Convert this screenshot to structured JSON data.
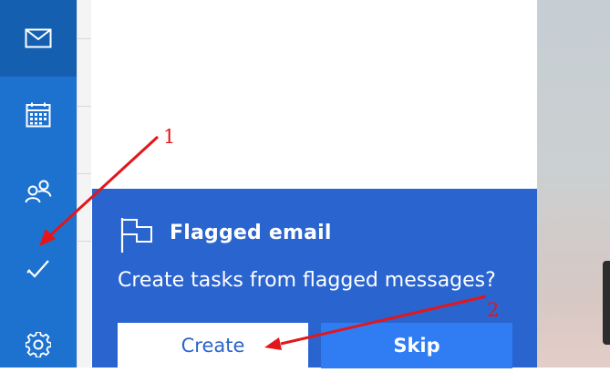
{
  "sidebar": {
    "items": [
      {
        "name": "mail",
        "icon": "mail-icon",
        "active": true
      },
      {
        "name": "calendar",
        "icon": "calendar-icon",
        "active": false
      },
      {
        "name": "people",
        "icon": "people-icon",
        "active": false
      },
      {
        "name": "todo",
        "icon": "checkmark-icon",
        "active": false
      },
      {
        "name": "settings",
        "icon": "gear-icon",
        "active": false
      }
    ]
  },
  "card": {
    "icon": "flag-icon",
    "title": "Flagged email",
    "question": "Create tasks from flagged messages?",
    "create_label": "Create",
    "skip_label": "Skip"
  },
  "annotations": {
    "marker_1": "1",
    "marker_2": "2",
    "color": "#e3161a"
  },
  "colors": {
    "rail": "#1d72d0",
    "rail_active": "#155fb1",
    "card": "#2a64cf",
    "skip_button": "#2f7cf3"
  }
}
